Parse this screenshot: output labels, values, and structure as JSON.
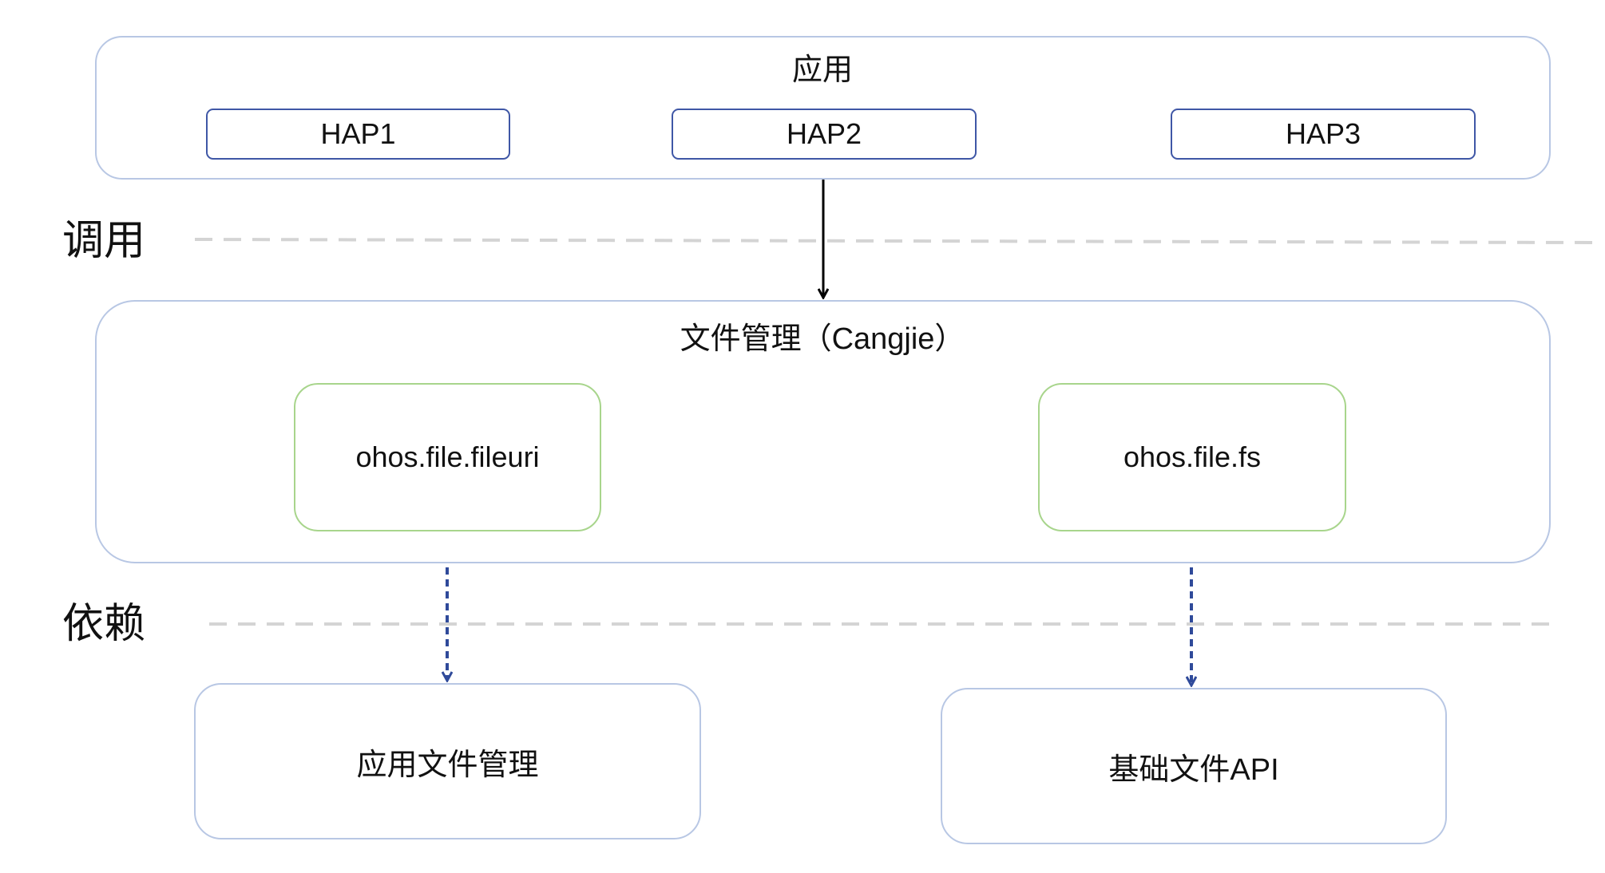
{
  "app_layer": {
    "title": "应用",
    "haps": [
      "HAP1",
      "HAP2",
      "HAP3"
    ]
  },
  "labels": {
    "call": "调用",
    "depend": "依赖"
  },
  "file_mgmt_layer": {
    "title": "文件管理（Cangjie）",
    "modules": [
      "ohos.file.fileuri",
      "ohos.file.fs"
    ]
  },
  "dependencies": [
    "应用文件管理",
    "基础文件API"
  ],
  "colors": {
    "layer_border": "#b8c7e4",
    "hap_border": "#3f57a6",
    "module_border": "#a8d58c",
    "dashed_divider": "#d4d4d4",
    "dependency_arrow": "#2f4a9a",
    "call_arrow": "#000000"
  }
}
